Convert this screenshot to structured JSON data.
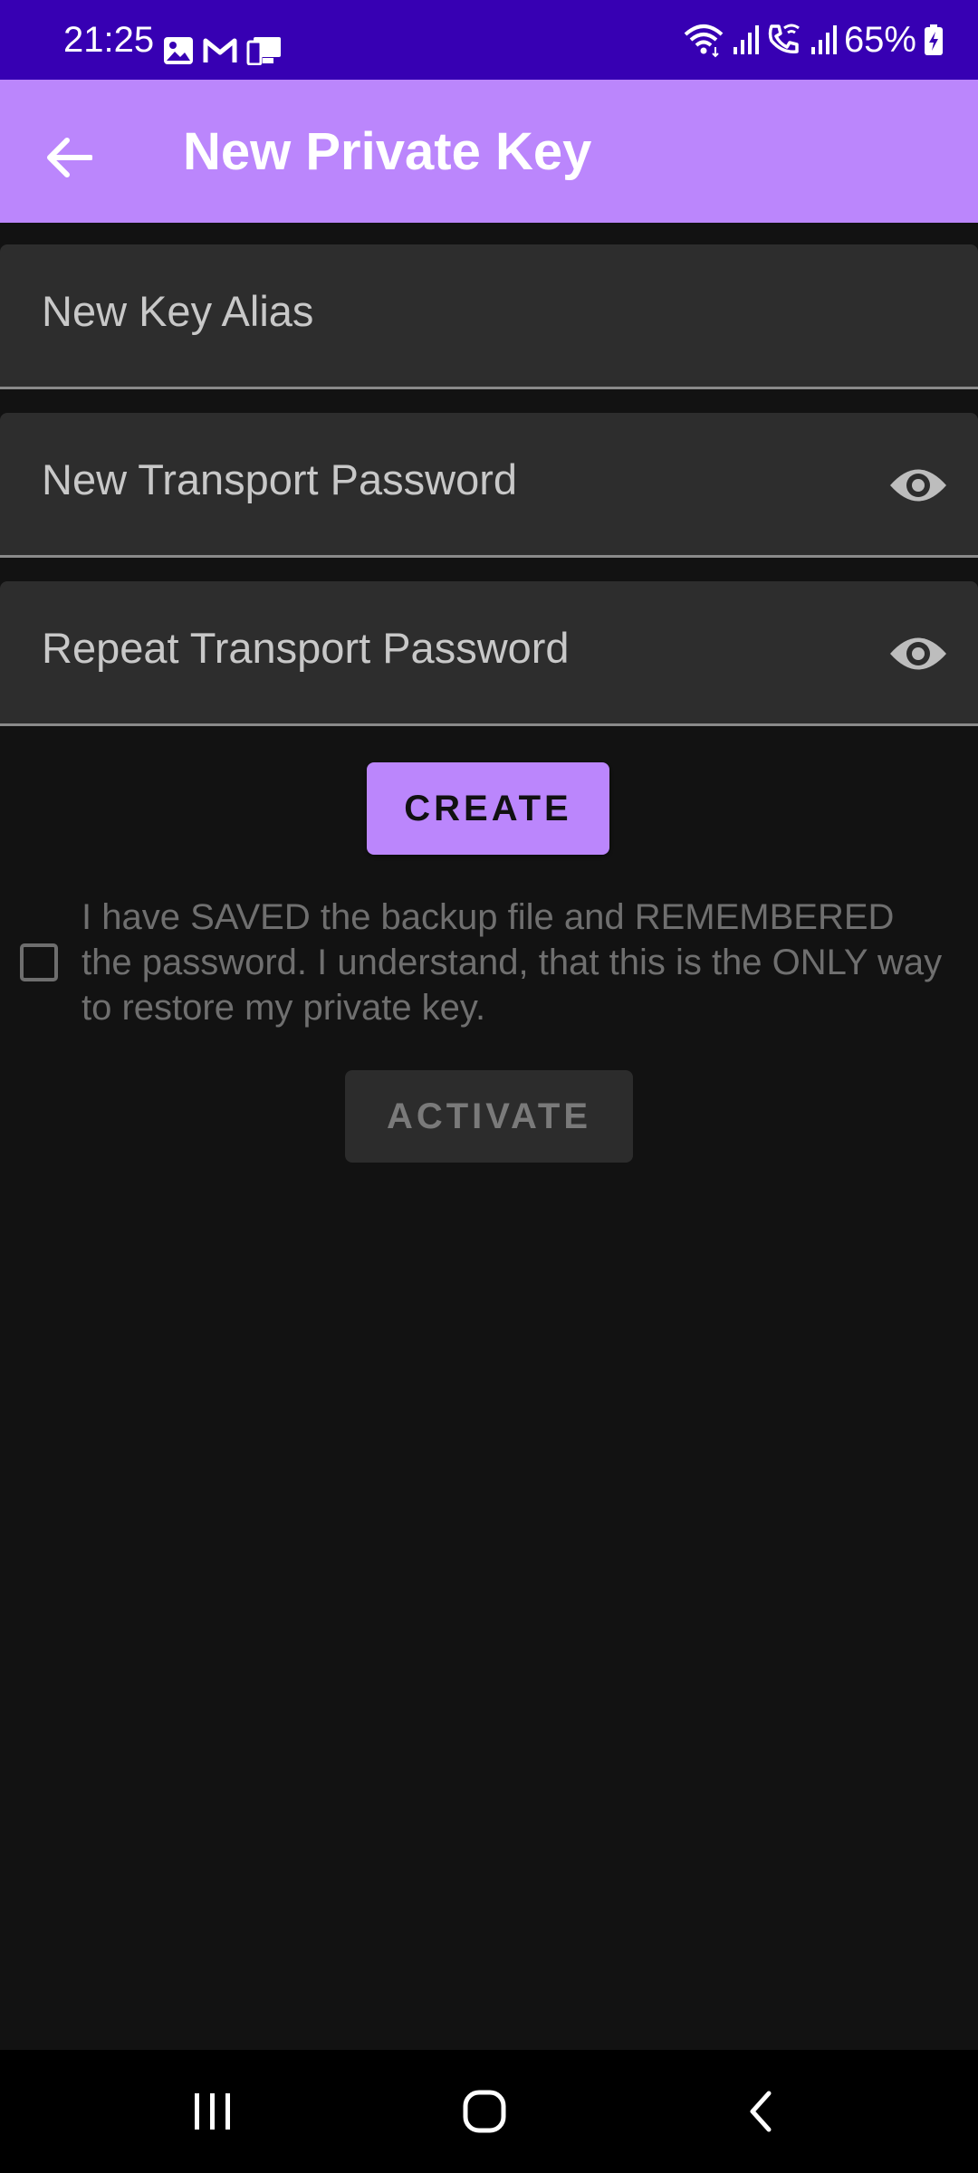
{
  "status_bar": {
    "time": "21:25",
    "battery": "65%",
    "left_icons": [
      "gallery-icon",
      "gmail-icon",
      "phone-link-icon"
    ],
    "right_icons": [
      "wifi-icon",
      "signal-icon",
      "wifi-calling-icon",
      "signal-icon",
      "battery-charging-icon"
    ]
  },
  "app_bar": {
    "title": "New Private Key",
    "back_icon": "arrow-back-icon",
    "background": "#bb86fc"
  },
  "form": {
    "alias_placeholder": "New Key Alias",
    "password_placeholder": "New Transport Password",
    "repeat_password_placeholder": "Repeat Transport Password",
    "visibility_icon": "eye-icon",
    "create_label": "CREATE",
    "confirm_text": "I have SAVED the backup file and REMEMBERED the password. I understand, that this is the ONLY way to restore my private key.",
    "confirm_checked": false,
    "activate_label": "ACTIVATE",
    "activate_enabled": false
  },
  "nav_bar": {
    "buttons": [
      "recents-icon",
      "home-icon",
      "back-icon"
    ]
  },
  "colors": {
    "status_bar": "#3700b3",
    "accent": "#bb86fc",
    "background": "#121212",
    "field_background": "#2d2d2d"
  }
}
